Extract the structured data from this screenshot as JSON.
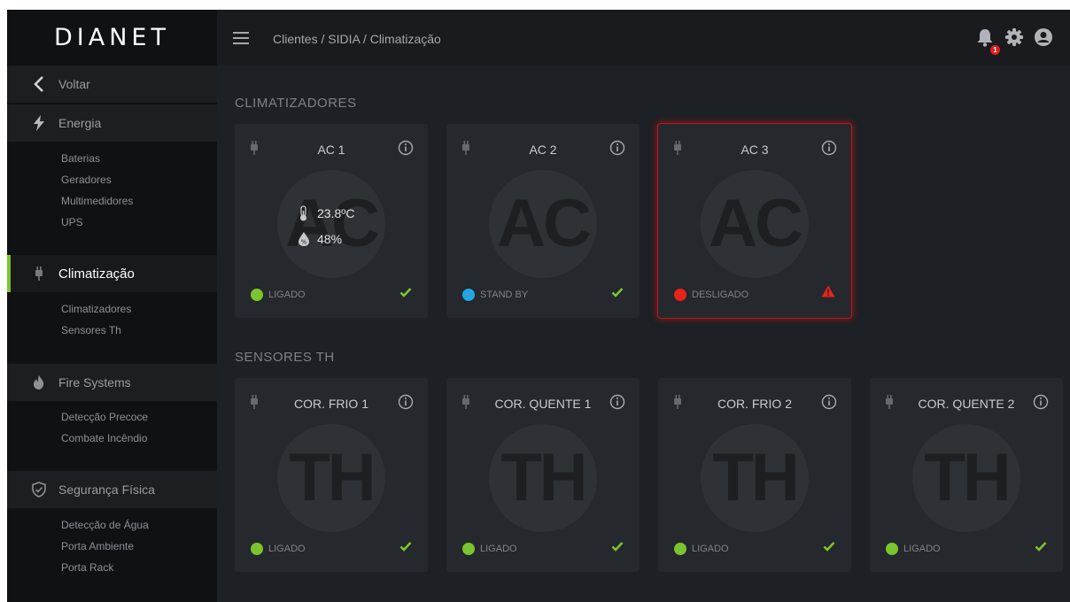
{
  "brand": {
    "logo_text": "DIANET"
  },
  "topbar": {
    "breadcrumb": "Clientes / SIDIA / Climatização",
    "notification_count": "1"
  },
  "sidebar": {
    "back_label": "Voltar",
    "sections": [
      {
        "label": "Energia",
        "items": [
          "Baterias",
          "Geradores",
          "Multimedidores",
          "UPS"
        ]
      },
      {
        "label": "Climatização",
        "items": [
          "Climatizadores",
          "Sensores Th"
        ]
      },
      {
        "label": "Fire Systems",
        "items": [
          "Detecção Precoce",
          "Combate Incêndio"
        ]
      },
      {
        "label": "Segurança Física",
        "items": [
          "Detecção de Água",
          "Porta Ambiente",
          "Porta Rack"
        ]
      }
    ]
  },
  "main": {
    "climatizadores_title": "CLIMATIZADORES",
    "sensores_title": "SENSORES TH",
    "climatizadores": [
      {
        "name": "AC 1",
        "placeholder": "AC",
        "temperature": "23.8ºC",
        "humidity": "48%",
        "status": "LIGADO",
        "status_color": "#7cc42e",
        "status_icon": "check-icon",
        "alert": false
      },
      {
        "name": "AC 2",
        "placeholder": "AC",
        "status": "STAND BY",
        "status_color": "#23a6e3",
        "status_icon": "check-icon",
        "alert": false
      },
      {
        "name": "AC 3",
        "placeholder": "AC",
        "status": "DESLIGADO",
        "status_color": "#e8231a",
        "status_icon": "warning-icon",
        "alert": true
      }
    ],
    "sensores": [
      {
        "name": "COR. FRIO 1",
        "placeholder": "TH",
        "status": "LIGADO",
        "status_color": "#7cc42e",
        "status_icon": "check-icon"
      },
      {
        "name": "COR. QUENTE 1",
        "placeholder": "TH",
        "status": "LIGADO",
        "status_color": "#7cc42e",
        "status_icon": "check-icon"
      },
      {
        "name": "COR. FRIO 2",
        "placeholder": "TH",
        "status": "LIGADO",
        "status_color": "#7cc42e",
        "status_icon": "check-icon"
      },
      {
        "name": "COR. QUENTE 2",
        "placeholder": "TH",
        "status": "LIGADO",
        "status_color": "#7cc42e",
        "status_icon": "check-icon"
      }
    ]
  },
  "colors": {
    "accent": "#7cc42e",
    "alert": "#e8231a",
    "standby": "#23a6e3"
  }
}
